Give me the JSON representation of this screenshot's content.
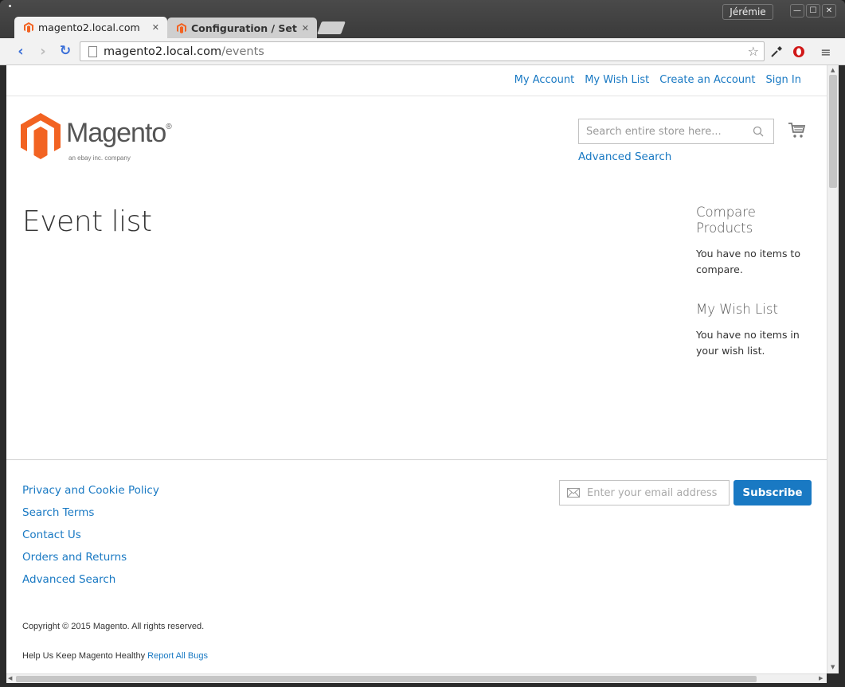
{
  "browser": {
    "user_name": "Jérémie",
    "tabs": [
      {
        "title": "magento2.local.com",
        "active": true
      },
      {
        "title": "Configuration / Sett",
        "active": false
      }
    ],
    "url_host": "magento2.local.com",
    "url_path": "/events"
  },
  "header": {
    "links": [
      "My Account",
      "My Wish List",
      "Create an Account",
      "Sign In"
    ],
    "logo_text": "Magento",
    "logo_mark": "®",
    "logo_tagline": "an ebay inc. company",
    "search_placeholder": "Search entire store here...",
    "advanced_search": "Advanced Search"
  },
  "main": {
    "title": "Event list"
  },
  "sidebar": {
    "compare_title": "Compare Products",
    "compare_text": "You have no items to compare.",
    "wishlist_title": "My Wish List",
    "wishlist_text": "You have no items in your wish list."
  },
  "footer": {
    "links": [
      "Privacy and Cookie Policy",
      "Search Terms",
      "Contact Us",
      "Orders and Returns",
      "Advanced Search"
    ],
    "newsletter_placeholder": "Enter your email address",
    "subscribe_label": "Subscribe",
    "copyright": "Copyright © 2015 Magento. All rights reserved.",
    "bugs_text": "Help Us Keep Magento Healthy",
    "bugs_link": "Report All Bugs"
  },
  "colors": {
    "link": "#1979c3",
    "brand_orange": "#f26322",
    "button_bg": "#1979c3"
  },
  "icons": [
    "magento-favicon",
    "back-arrow-icon",
    "forward-arrow-icon",
    "reload-icon",
    "page-icon",
    "star-icon",
    "eyedropper-icon",
    "opera-icon",
    "menu-icon",
    "search-icon",
    "cart-icon",
    "envelope-icon"
  ]
}
